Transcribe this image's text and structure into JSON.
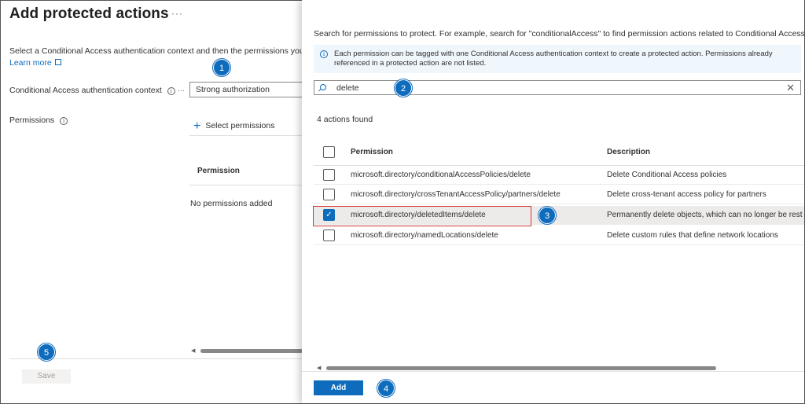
{
  "left": {
    "title": "Add protected actions",
    "more": "···",
    "intro": "Select a Conditional Access authentication context and then the permissions you wa",
    "learn_more": "Learn more",
    "context_label": "Conditional Access authentication context",
    "context_value": "Strong authorization",
    "permissions_label": "Permissions",
    "select_permissions": "Select permissions",
    "permission_column": "Permission",
    "no_permissions": "No permissions added",
    "save_label": "Save"
  },
  "right": {
    "search_hint": "Search for permissions to protect. For example, search for \"conditionalAccess\" to find permission actions related to Conditional Access.",
    "banner": "Each permission can be tagged with one Conditional Access authentication context to create a protected action. Permissions already referenced in a protected action are not listed.",
    "search_value": "delete",
    "found_text": "4 actions found",
    "columns": {
      "permission": "Permission",
      "description": "Description"
    },
    "rows": [
      {
        "permission": "microsoft.directory/conditionalAccessPolicies/delete",
        "description": "Delete Conditional Access policies",
        "checked": false
      },
      {
        "permission": "microsoft.directory/crossTenantAccessPolicy/partners/delete",
        "description": "Delete cross-tenant access policy for partners",
        "checked": false
      },
      {
        "permission": "microsoft.directory/deletedItems/delete",
        "description": "Permanently delete objects, which can no longer be rest",
        "checked": true
      },
      {
        "permission": "microsoft.directory/namedLocations/delete",
        "description": "Delete custom rules that define network locations",
        "checked": false
      }
    ],
    "add_label": "Add"
  },
  "markers": [
    "1",
    "2",
    "3",
    "4",
    "5"
  ],
  "colors": {
    "accent": "#0f6cbd",
    "highlight": "#d13438"
  }
}
